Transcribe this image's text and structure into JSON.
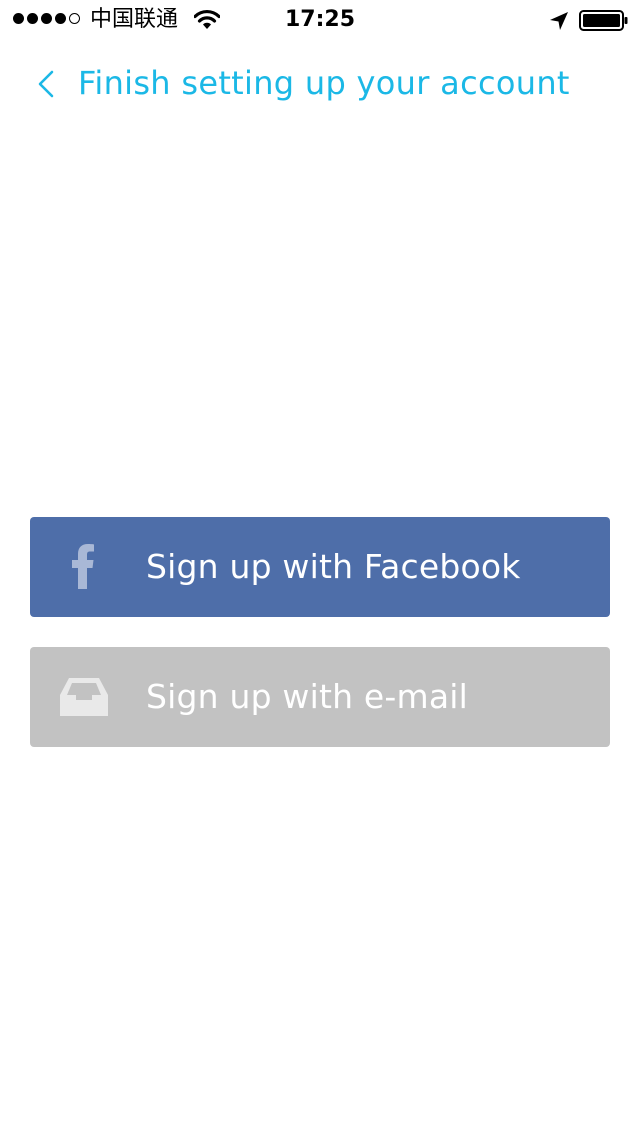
{
  "status_bar": {
    "carrier": "中国联通",
    "time": "17:25",
    "signal_bars_filled": 4,
    "signal_bars_total": 5,
    "icons": [
      "signal-dots-icon",
      "wifi-icon",
      "location-arrow-icon",
      "battery-icon"
    ]
  },
  "nav": {
    "title": "Finish setting up your account",
    "back_icon": "chevron-left-icon",
    "accent_color": "#1BB8E6"
  },
  "buttons": {
    "facebook": {
      "label": "Sign up with Facebook",
      "icon": "facebook-icon",
      "color": "#4E6EA9"
    },
    "email": {
      "label": "Sign up with e-mail",
      "icon": "inbox-tray-icon",
      "color": "#C2C2C2"
    }
  }
}
